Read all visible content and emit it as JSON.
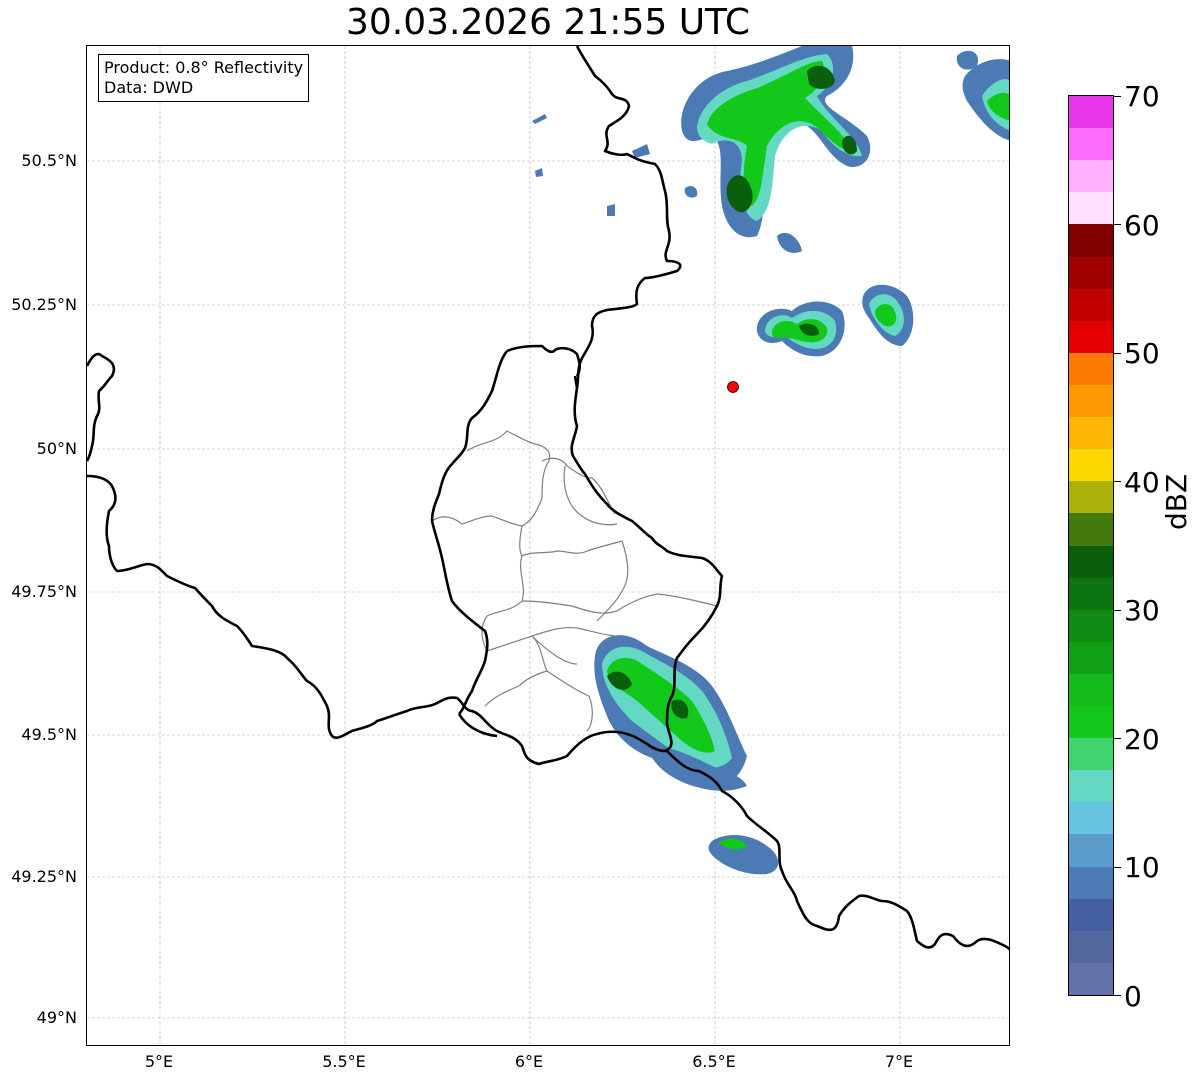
{
  "title": "30.03.2026 21:55 UTC",
  "info": {
    "product": "Product: 0.8° Reflectivity",
    "data": "Data: DWD"
  },
  "axes": {
    "lat_labels": [
      "50.5°N",
      "50.25°N",
      "50°N",
      "49.75°N",
      "49.5°N",
      "49.25°N",
      "49°N"
    ],
    "lon_labels": [
      "5°E",
      "5.5°E",
      "6°E",
      "6.5°E",
      "7°E"
    ]
  },
  "colorbar": {
    "label": "dBZ",
    "ticks": [
      "0",
      "10",
      "20",
      "30",
      "40",
      "50",
      "60",
      "70"
    ],
    "colors": [
      "#6272a8",
      "#5468a0",
      "#455fa3",
      "#4b7ab4",
      "#5a9dcb",
      "#67c4e0",
      "#63d9c4",
      "#3fd46f",
      "#12c81b",
      "#14b91a",
      "#119f16",
      "#0f8a12",
      "#0d7510",
      "#0a5f0d",
      "#447a0d",
      "#abb20b",
      "#fdd800",
      "#fcb500",
      "#fc9900",
      "#fc7b00",
      "#e50000",
      "#c20000",
      "#a10000",
      "#800000",
      "#ffe0ff",
      "#ffb0ff",
      "#ff6dff",
      "#e838ea"
    ]
  },
  "map": {
    "radar_site_color": "#ff0000",
    "border_color": "#000000",
    "district_color": "#808080"
  }
}
